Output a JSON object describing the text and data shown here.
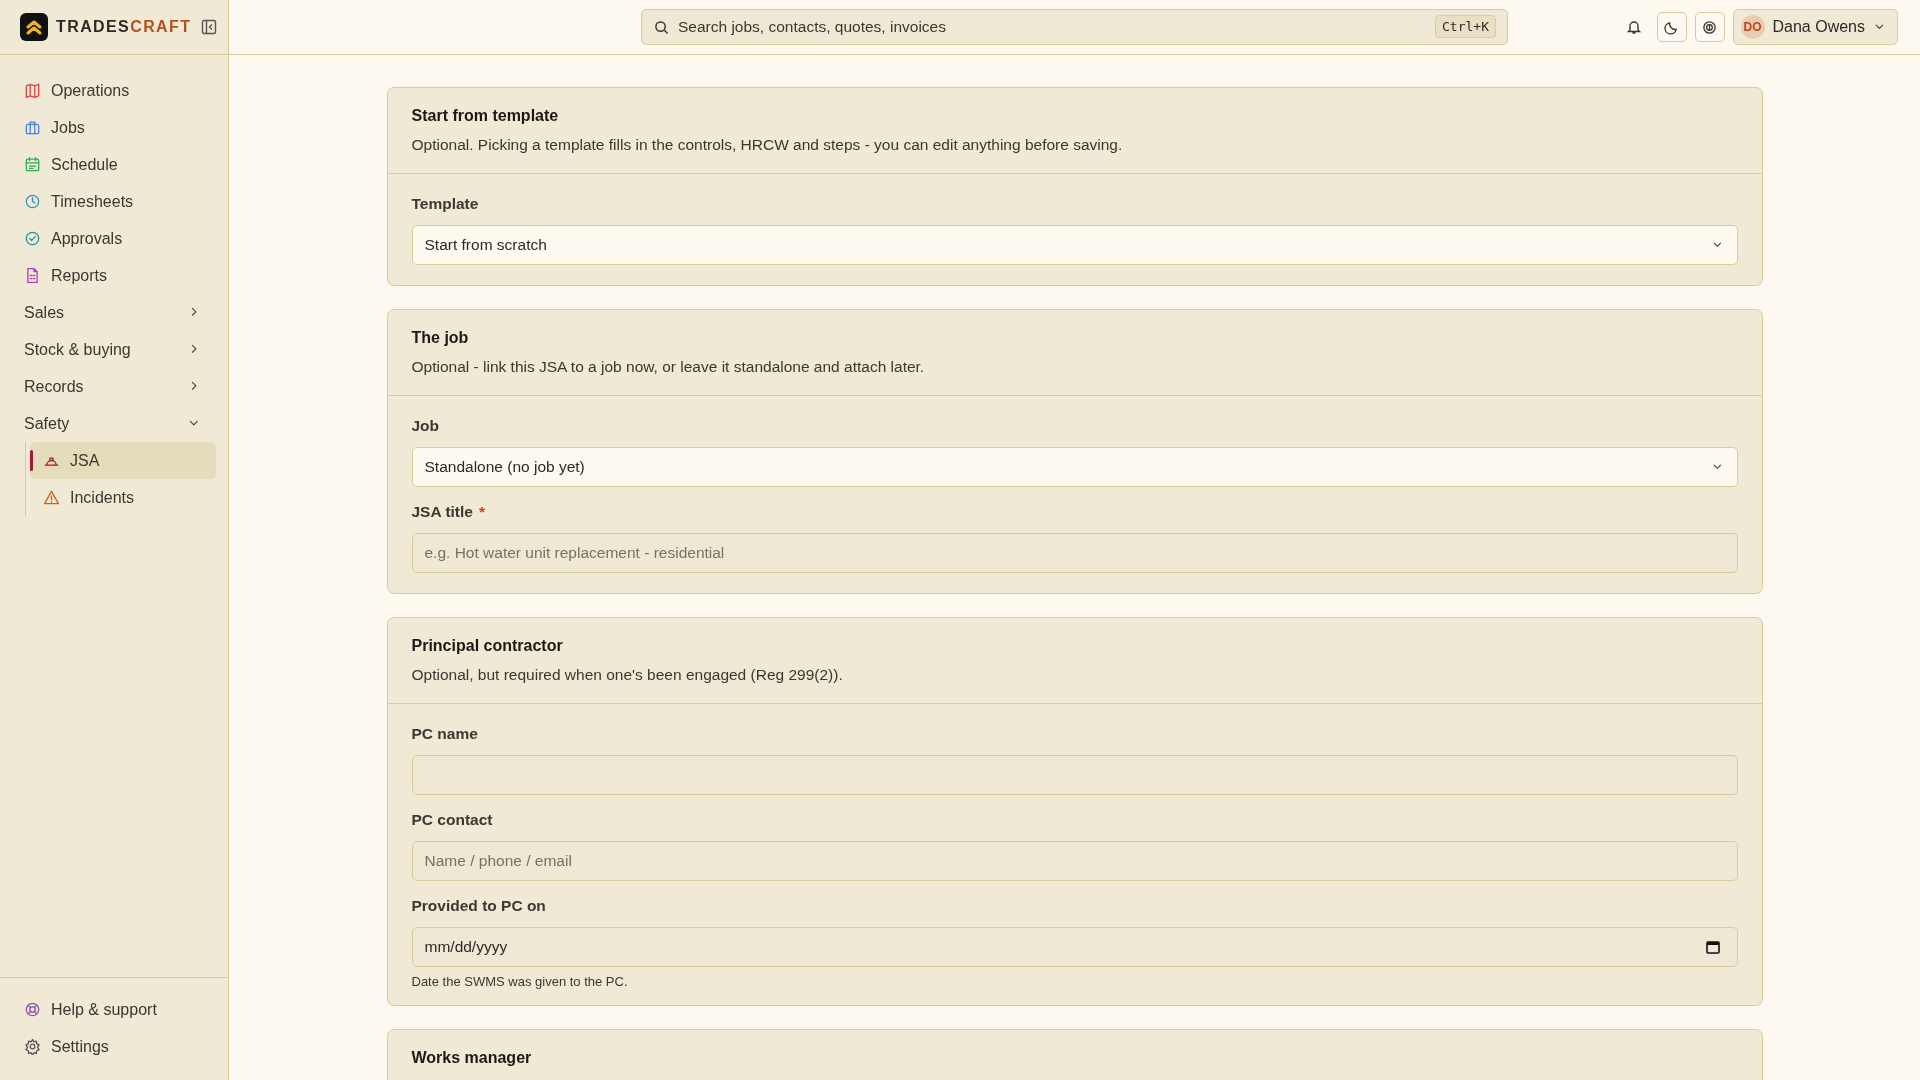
{
  "brand": {
    "name_dark": "TRADES",
    "name_accent": "CRAFT"
  },
  "sidebar": {
    "items": [
      {
        "kind": "link",
        "label": "Operations",
        "selected": false
      },
      {
        "kind": "link",
        "label": "Jobs",
        "selected": false
      },
      {
        "kind": "link",
        "label": "Schedule",
        "selected": false
      },
      {
        "kind": "link",
        "label": "Timesheets",
        "selected": false
      },
      {
        "kind": "link",
        "label": "Approvals",
        "selected": false
      },
      {
        "kind": "link",
        "label": "Reports",
        "selected": false
      },
      {
        "kind": "group",
        "label": "Sales",
        "expanded": false
      },
      {
        "kind": "group",
        "label": "Stock & buying",
        "expanded": false
      },
      {
        "kind": "group",
        "label": "Records",
        "expanded": false
      },
      {
        "kind": "group",
        "label": "Safety",
        "expanded": true,
        "children": [
          {
            "kind": "link",
            "label": "JSA",
            "selected": true
          },
          {
            "kind": "link",
            "label": "Incidents",
            "selected": false
          }
        ]
      }
    ],
    "footer": [
      {
        "label": "Help & support"
      },
      {
        "label": "Settings"
      }
    ]
  },
  "topbar": {
    "search": {
      "placeholder": "Search jobs, contacts, quotes, invoices",
      "shortcut": "Ctrl+K"
    },
    "user": {
      "initials": "DO",
      "name": "Dana Owens"
    }
  },
  "cards": [
    {
      "title": "Start from template",
      "description": "Optional. Picking a template fills in the controls, HRCW and steps - you can edit anything before saving.",
      "fields": [
        {
          "kind": "select",
          "label": "Template",
          "value": "Start from scratch"
        }
      ]
    },
    {
      "title": "The job",
      "description": "Optional - link this JSA to a job now, or leave it standalone and attach later.",
      "fields": [
        {
          "kind": "select",
          "label": "Job",
          "value": "Standalone (no job yet)"
        },
        {
          "kind": "text",
          "label": "JSA title",
          "required_mark": "*",
          "placeholder": "e.g. Hot water unit replacement - residential"
        }
      ]
    },
    {
      "title": "Principal contractor",
      "description": "Optional, but required when one's been engaged (Reg 299(2)).",
      "fields": [
        {
          "kind": "text",
          "label": "PC name"
        },
        {
          "kind": "text",
          "label": "PC contact",
          "placeholder": "Name / phone / email"
        },
        {
          "kind": "date",
          "label": "Provided to PC on",
          "placeholder": "mm/dd/yyyy",
          "help": "Date the SWMS was given to the PC."
        }
      ]
    },
    {
      "title": "Works manager"
    }
  ]
}
